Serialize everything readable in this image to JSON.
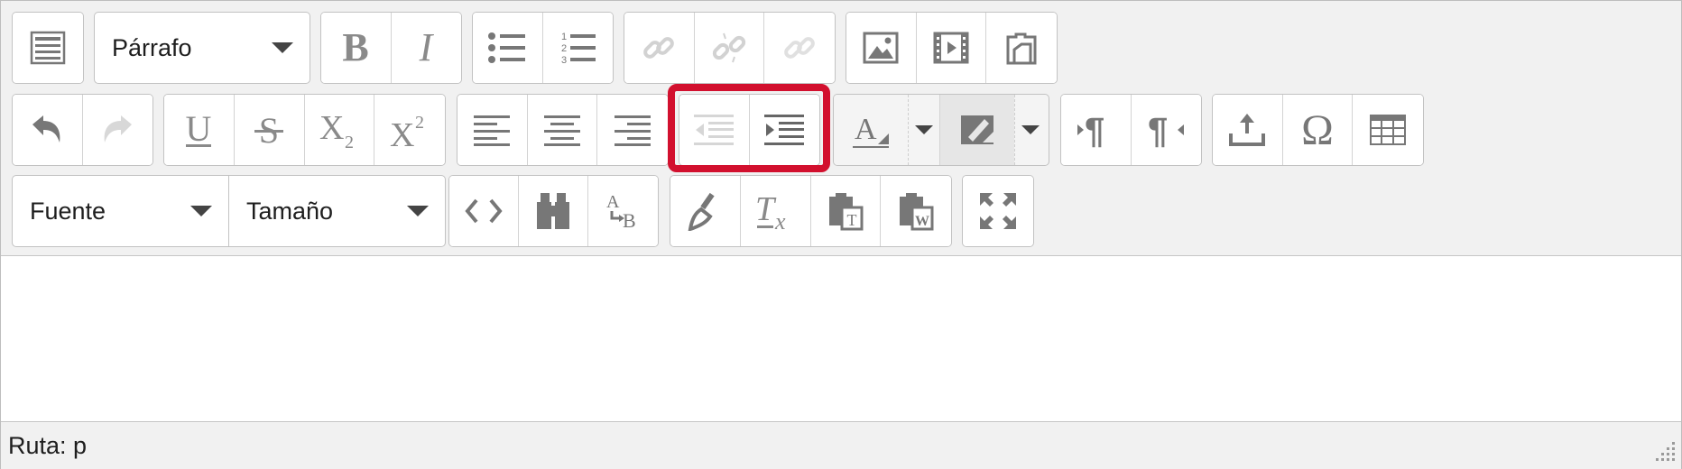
{
  "toolbar": {
    "row1": {
      "toggle_icon": "toolbar-toggle-icon",
      "format_select": {
        "value": "Párrafo"
      },
      "bold": "bold-icon",
      "italic": "italic-icon",
      "unordered_list": "bullet-list-icon",
      "ordered_list": "numbered-list-icon",
      "link": "link-icon",
      "unlink": "unlink-icon",
      "anchor": "anchor-link-icon",
      "image": "image-icon",
      "media": "media-icon",
      "manage_files": "manage-files-icon"
    },
    "row2": {
      "undo": "undo-icon",
      "redo": "redo-icon",
      "underline": "underline-icon",
      "strikethrough": "strikethrough-icon",
      "subscript": "subscript-icon",
      "superscript": "superscript-icon",
      "align_left": "align-left-icon",
      "align_center": "align-center-icon",
      "align_right": "align-right-icon",
      "outdent": "outdent-icon",
      "indent": "indent-icon",
      "text_color": "text-color-icon",
      "background_color": "background-color-icon",
      "ltr": "ltr-icon",
      "rtl": "rtl-icon",
      "upload": "upload-icon",
      "special_char": "omega-icon",
      "table": "table-icon"
    },
    "row3": {
      "font_select": {
        "value": "Fuente"
      },
      "size_select": {
        "value": "Tamaño"
      },
      "code": "code-icon",
      "find": "binoculars-icon",
      "replace": "replace-icon",
      "cleanup": "broom-icon",
      "remove_format": "remove-format-icon",
      "paste_text": "paste-text-icon",
      "paste_word": "paste-word-icon",
      "fullscreen": "fullscreen-icon"
    },
    "highlight_color": "#d2102e",
    "icon_color": "#7a7a7a",
    "disabled_icon_color": "#d0d0d0"
  },
  "statusbar": {
    "path_label": "Ruta: p"
  }
}
